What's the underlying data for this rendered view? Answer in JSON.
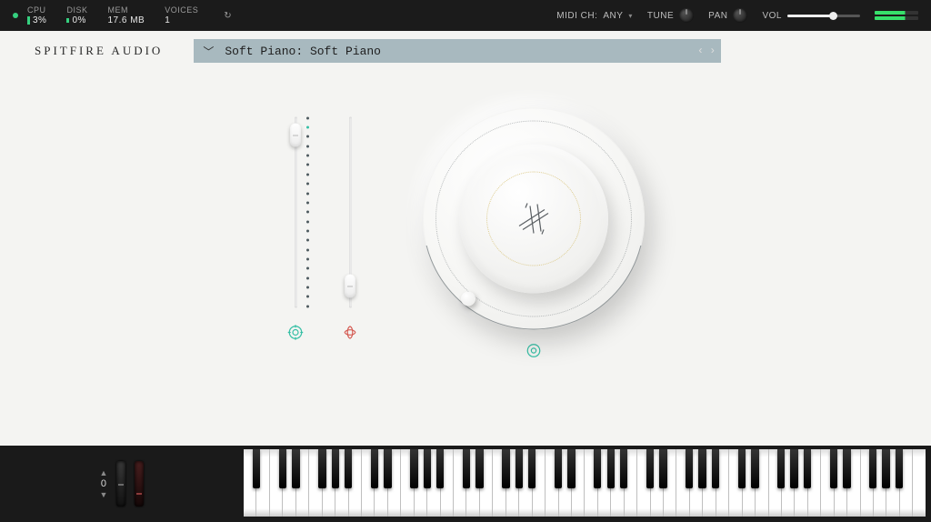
{
  "topbar": {
    "cpu": {
      "label": "CPU",
      "value": "3%"
    },
    "disk": {
      "label": "DISK",
      "value": "0%"
    },
    "mem": {
      "label": "MEM",
      "value": "17.6 MB"
    },
    "voices": {
      "label": "VOICES",
      "value": "1"
    },
    "midi": {
      "label": "MIDI CH:",
      "value": "ANY"
    },
    "tune": {
      "label": "TUNE"
    },
    "pan": {
      "label": "PAN"
    },
    "vol": {
      "label": "VOL",
      "level_pct": 62
    }
  },
  "brand": "SPITFIRE AUDIO",
  "preset": {
    "name": "Soft Piano: Soft Piano"
  },
  "sliders": {
    "a": {
      "icon": "expression-icon",
      "value_pct": 96
    },
    "b": {
      "icon": "dynamics-icon",
      "value_pct": 6
    }
  },
  "dial": {
    "icon": "reverb-icon",
    "value_pct": 18
  },
  "keyboard": {
    "octave_shift": "0",
    "white_key_count": 52,
    "black_pattern": [
      1,
      1,
      0,
      1,
      1,
      1,
      0
    ]
  }
}
